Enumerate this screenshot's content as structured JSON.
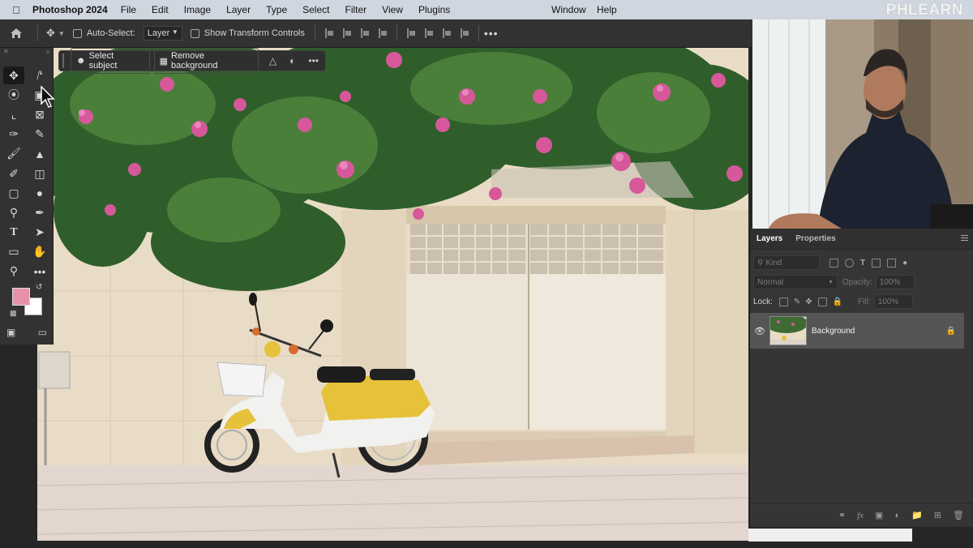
{
  "menubar": {
    "app_name": "Photoshop 2024",
    "items": [
      "File",
      "Edit",
      "Image",
      "Layer",
      "Type",
      "Select",
      "Filter",
      "View",
      "Plugins"
    ],
    "window_label": "Window",
    "help_label": "Help",
    "brand": "PHLEARN"
  },
  "options_bar": {
    "auto_select_label": "Auto-Select:",
    "auto_select_value": "Layer",
    "show_transform_label": "Show Transform Controls"
  },
  "context_bar": {
    "select_subject": "Select subject",
    "remove_background": "Remove background"
  },
  "toolbar": {
    "foreground_color": "#e991a8",
    "background_color": "#ffffff",
    "tools": [
      "move-tool-icon",
      "marquee-tool-icon",
      "lasso-tool-icon",
      "object-selection-tool-icon",
      "crop-tool-icon",
      "frame-tool-icon",
      "eyedropper-tool-icon",
      "healing-brush-icon",
      "brush-tool-icon",
      "clone-stamp-icon",
      "history-brush-icon",
      "eraser-tool-icon",
      "gradient-tool-icon",
      "blur-tool-icon",
      "dodge-tool-icon",
      "pen-tool-icon",
      "type-tool-icon",
      "path-selection-icon",
      "rectangle-tool-icon",
      "hand-tool-icon",
      "zoom-tool-icon",
      "more-tools-icon"
    ]
  },
  "layers_panel": {
    "tabs": [
      "Layers",
      "Properties"
    ],
    "kind_placeholder": "Kind",
    "blend_mode": "Normal",
    "opacity_label": "Opacity:",
    "opacity_value": "100%",
    "lock_label": "Lock:",
    "fill_label": "Fill:",
    "fill_value": "100%",
    "layers": [
      {
        "name": "Background",
        "visible": true,
        "locked": true
      }
    ]
  }
}
